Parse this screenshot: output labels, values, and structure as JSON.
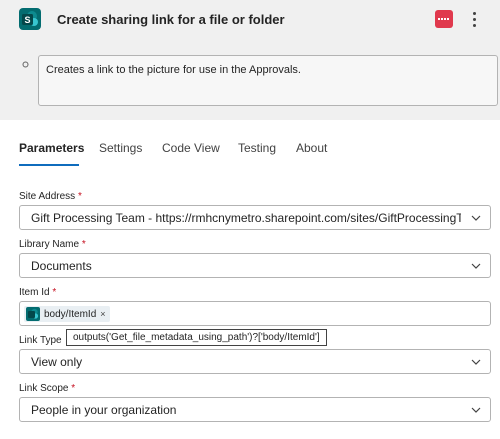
{
  "header": {
    "title": "Create sharing link for a file or folder",
    "app_icon": "sharepoint-icon",
    "app_icon_letter": "S"
  },
  "description": {
    "text": "Creates a link to the picture for use in the Approvals."
  },
  "tabs": [
    {
      "label": "Parameters",
      "active": true
    },
    {
      "label": "Settings",
      "active": false
    },
    {
      "label": "Code View",
      "active": false
    },
    {
      "label": "Testing",
      "active": false
    },
    {
      "label": "About",
      "active": false
    }
  ],
  "fields": {
    "site_address": {
      "label": "Site Address",
      "required": "*",
      "value": "Gift Processing Team - https://rmhcnymetro.sharepoint.com/sites/GiftProcessingT..."
    },
    "library_name": {
      "label": "Library Name",
      "required": "*",
      "value": "Documents"
    },
    "item_id": {
      "label": "Item Id",
      "required": "*",
      "token": "body/ItemId",
      "token_remove": "×"
    },
    "link_type": {
      "label": "Link Type",
      "value": "View only"
    },
    "link_scope": {
      "label": "Link Scope",
      "required": "*",
      "value": "People in your organization"
    }
  },
  "tooltip": {
    "text": "outputs('Get_file_metadata_using_path')?['body/ItemId']"
  },
  "colors": {
    "accent": "#0f6cbd",
    "sharepoint": "#036c70",
    "danger": "#e0394d",
    "required": "#c50f1f"
  }
}
